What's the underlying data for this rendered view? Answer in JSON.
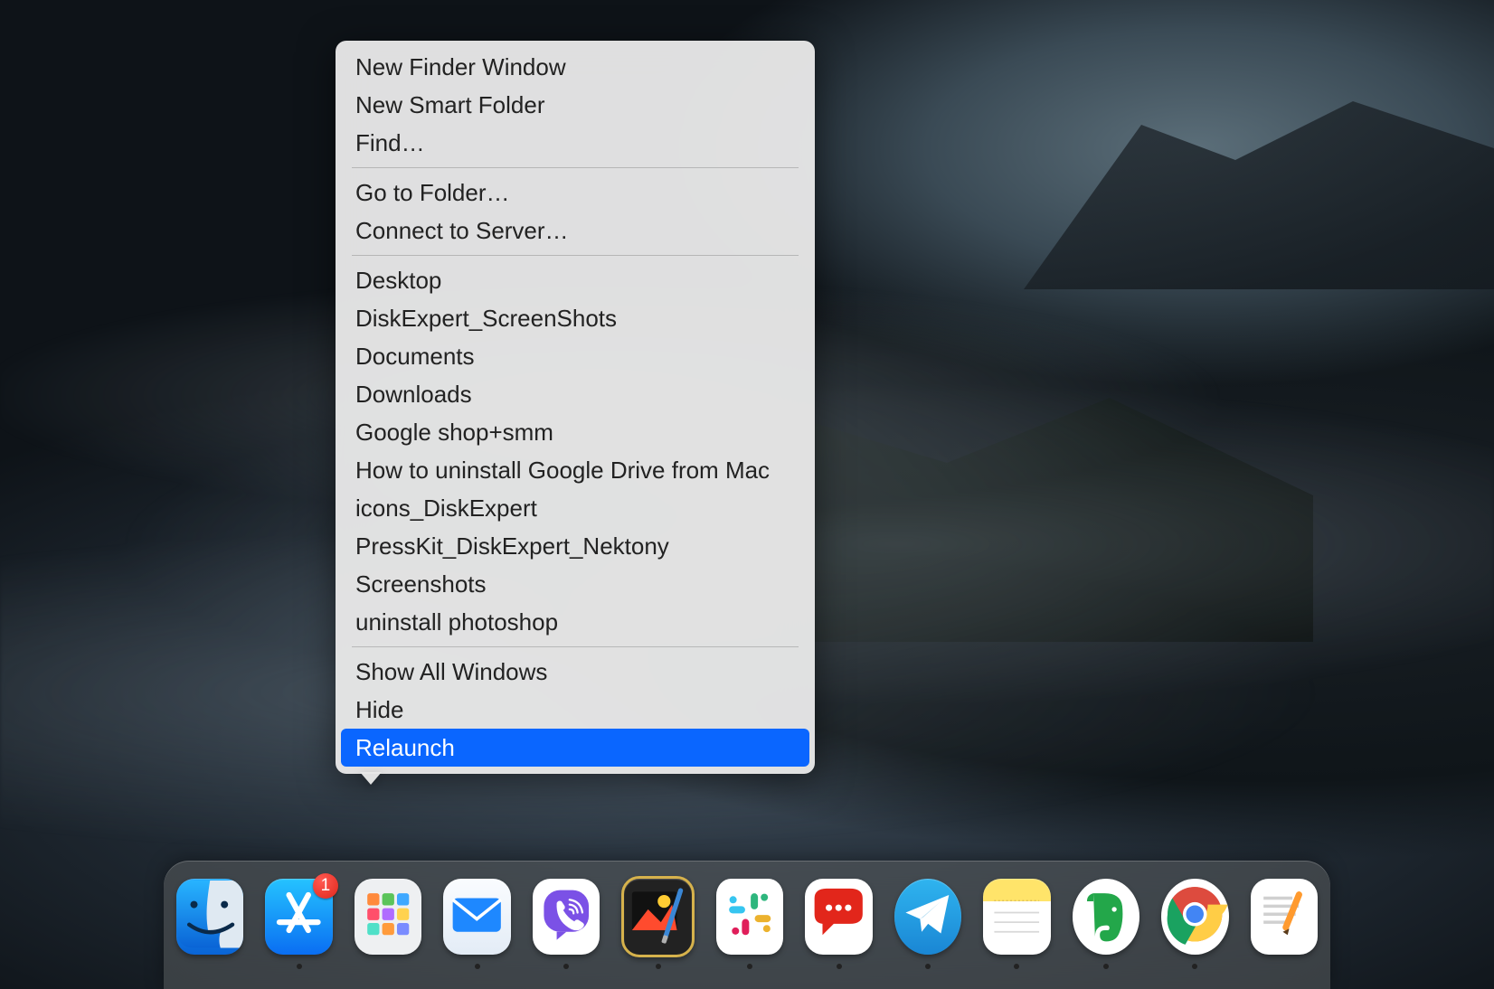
{
  "context_menu": {
    "groups": [
      [
        {
          "label": "New Finder Window",
          "highlighted": false
        },
        {
          "label": "New Smart Folder",
          "highlighted": false
        },
        {
          "label": "Find…",
          "highlighted": false
        }
      ],
      [
        {
          "label": "Go to Folder…",
          "highlighted": false
        },
        {
          "label": "Connect to Server…",
          "highlighted": false
        }
      ],
      [
        {
          "label": "Desktop",
          "highlighted": false
        },
        {
          "label": "DiskExpert_ScreenShots",
          "highlighted": false
        },
        {
          "label": "Documents",
          "highlighted": false
        },
        {
          "label": "Downloads",
          "highlighted": false
        },
        {
          "label": "Google shop+smm",
          "highlighted": false
        },
        {
          "label": "How to uninstall Google Drive from Mac",
          "highlighted": false
        },
        {
          "label": "icons_DiskExpert",
          "highlighted": false
        },
        {
          "label": "PressKit_DiskExpert_Nektony",
          "highlighted": false
        },
        {
          "label": "Screenshots",
          "highlighted": false
        },
        {
          "label": "uninstall photoshop",
          "highlighted": false
        }
      ],
      [
        {
          "label": "Show All Windows",
          "highlighted": false
        },
        {
          "label": "Hide",
          "highlighted": false
        },
        {
          "label": "Relaunch",
          "highlighted": true
        }
      ]
    ]
  },
  "dock": {
    "items": [
      {
        "id": "finder",
        "running": true,
        "badge": null
      },
      {
        "id": "appstore",
        "running": true,
        "badge": "1"
      },
      {
        "id": "launchpad",
        "running": false,
        "badge": null
      },
      {
        "id": "mail",
        "running": true,
        "badge": null
      },
      {
        "id": "viber",
        "running": true,
        "badge": null
      },
      {
        "id": "pixelmator",
        "running": true,
        "badge": null
      },
      {
        "id": "slack",
        "running": true,
        "badge": null
      },
      {
        "id": "chatapp",
        "running": true,
        "badge": null
      },
      {
        "id": "telegram",
        "running": true,
        "badge": null
      },
      {
        "id": "notes",
        "running": true,
        "badge": null
      },
      {
        "id": "evernote",
        "running": true,
        "badge": null
      },
      {
        "id": "chrome",
        "running": true,
        "badge": null
      },
      {
        "id": "pages",
        "running": false,
        "badge": null
      }
    ]
  }
}
